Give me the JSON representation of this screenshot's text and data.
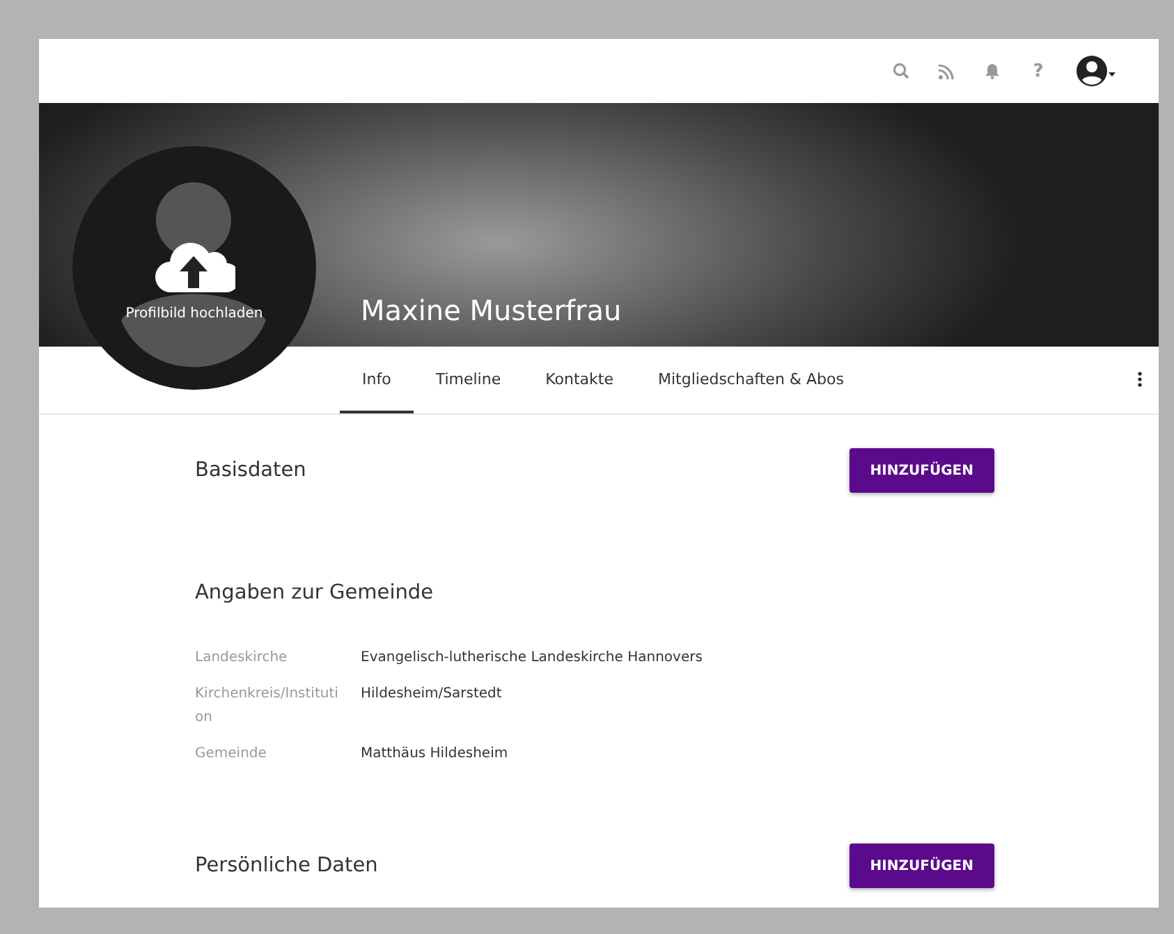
{
  "topbar": {
    "icons": [
      {
        "kind": "search"
      },
      {
        "kind": "feed"
      },
      {
        "kind": "bell"
      },
      {
        "kind": "help",
        "glyph": "?"
      },
      {
        "kind": "user"
      }
    ]
  },
  "profile": {
    "upload_label": "Profilbild hochladen",
    "name": "Maxine Musterfrau"
  },
  "tabs": [
    {
      "label": "Info",
      "selected": true
    },
    {
      "label": "Timeline",
      "selected": false
    },
    {
      "label": "Kontakte",
      "selected": false
    },
    {
      "label": "Mitgliedschaften & Abos",
      "selected": false
    }
  ],
  "sections": [
    {
      "title": "Basisdaten",
      "button": "HINZUFÜGEN"
    },
    {
      "title": "Angaben zur Gemeinde",
      "rows": [
        {
          "label": "Landeskirche",
          "value": "Evangelisch-lutherische Landeskirche Hannovers"
        },
        {
          "label": "Kirchenkreis/Institution",
          "value": "Hildesheim/Sarstedt"
        },
        {
          "label": "Gemeinde",
          "value": "Matthäus Hildesheim"
        }
      ]
    },
    {
      "title": "Persönliche Daten",
      "button": "HINZUFÜGEN"
    }
  ]
}
